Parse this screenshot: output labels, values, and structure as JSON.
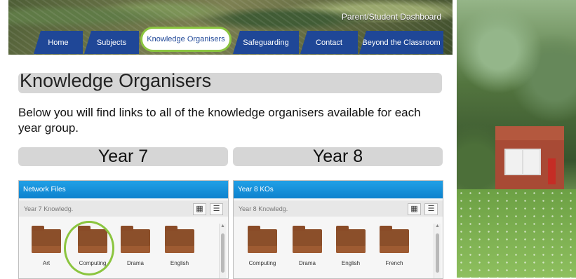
{
  "header": {
    "dashboard_link": "Parent/Student Dashboard"
  },
  "nav": [
    {
      "label": "Home"
    },
    {
      "label": "Subjects"
    },
    {
      "label": "Knowledge Organisers",
      "active": true
    },
    {
      "label": "Safeguarding"
    },
    {
      "label": "Contact"
    },
    {
      "label": "Beyond the Classroom"
    }
  ],
  "main": {
    "title": "Knowledge Organisers",
    "intro": "Below you will find links to all of the knowledge organisers available for each year group."
  },
  "years": [
    {
      "title": "Year 7",
      "panel_title": "Network Files",
      "path": "Year 7 Knowledg.",
      "files": [
        "Art",
        "Computing",
        "Drama",
        "English"
      ]
    },
    {
      "title": "Year 8",
      "panel_title": "Year 8 KOs",
      "path": "Year 8 Knowledg.",
      "files": [
        "Computing",
        "Drama",
        "English",
        "French"
      ]
    }
  ],
  "colors": {
    "nav": "#1f4797",
    "highlight": "#8bc53f",
    "folder": "#8b4f2a",
    "panel_header": "#0d82ce"
  },
  "icons": {
    "grid": "grid-view-icon",
    "list": "list-view-icon",
    "folder": "folder-icon"
  }
}
